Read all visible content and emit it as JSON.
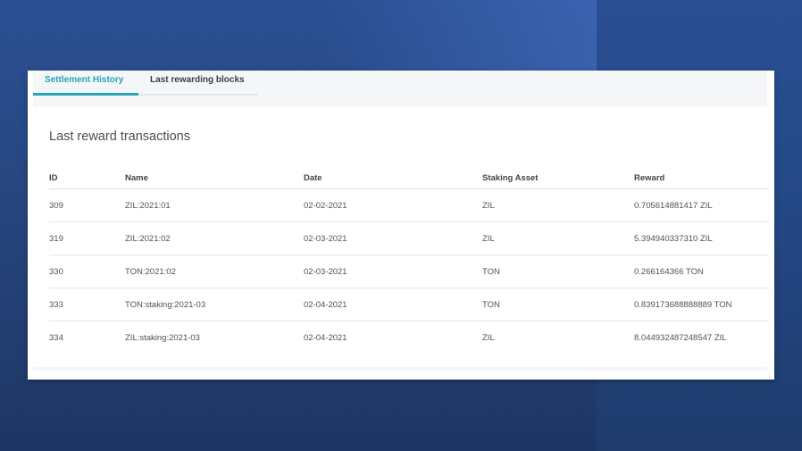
{
  "tabs": [
    {
      "label": "Settlement History",
      "active": true
    },
    {
      "label": "Last rewarding blocks",
      "active": false
    }
  ],
  "section_title": "Last reward transactions",
  "table": {
    "headers": [
      "ID",
      "Name",
      "Date",
      "Staking Asset",
      "Reward"
    ],
    "rows": [
      [
        "309",
        "ZIL:2021:01",
        "02-02-2021",
        "ZIL",
        "0.705614881417 ZIL"
      ],
      [
        "319",
        "ZIL:2021:02",
        "02-03-2021",
        "ZIL",
        "5.394940337310 ZIL"
      ],
      [
        "330",
        "TON:2021:02",
        "02-03-2021",
        "TON",
        "0.266164366 TON"
      ],
      [
        "333",
        "TON:staking:2021-03",
        "02-04-2021",
        "TON",
        "0.839173688888889 TON"
      ],
      [
        "334",
        "ZIL:staking:2021-03",
        "02-04-2021",
        "ZIL",
        "8.044932487248547 ZIL"
      ]
    ]
  },
  "colors": {
    "accent": "#27a4b5",
    "background": "#27467f"
  }
}
